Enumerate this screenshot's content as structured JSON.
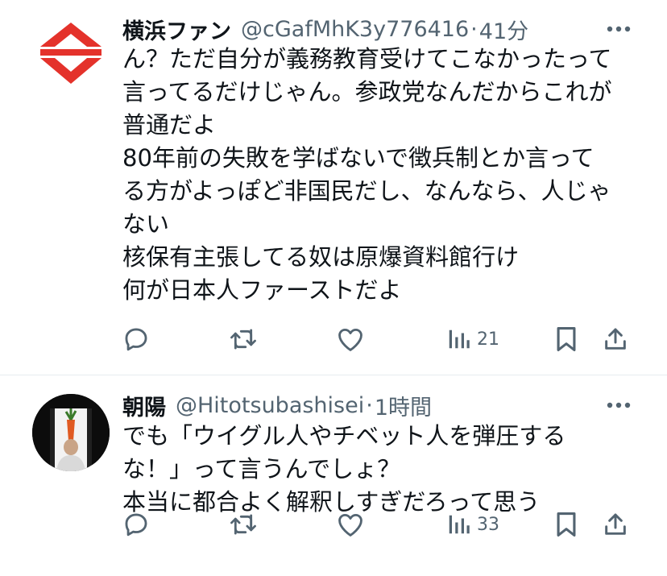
{
  "tweets": [
    {
      "display_name": "横浜ファン",
      "handle": "@cGafMhK3y776416",
      "separator": "·",
      "time": "41分",
      "avatar_icon": "red-diamond-logo-icon",
      "lines": [
        "ん？ただ自分が義務教育受けてこなかったって",
        "言ってるだけじゃん。参政党なんだからこれが",
        "普通だよ",
        "80年前の失敗を学ばないで徴兵制とか言って",
        "る方がよっぽど非国民だし、なんなら、人じゃ",
        "ない",
        "核保有主張してる奴は原爆資料館行け",
        "何が日本人ファーストだよ"
      ],
      "views": "21"
    },
    {
      "display_name": "朝陽",
      "handle": "@Hitotsubashisei",
      "separator": "·",
      "time": "1時間",
      "avatar_icon": "person-photo-icon",
      "lines": [
        "でも「ウイグル人やチベット人を弾圧する",
        "な！」って言うんでしょ？",
        "本当に都合よく解釈しすぎだろって思う"
      ],
      "views": "33"
    }
  ],
  "colors": {
    "text": "#0f1419",
    "muted": "#536471",
    "divider": "#e6ecf0",
    "logo_red": "#e4322b"
  },
  "icons": [
    "more-icon",
    "reply-icon",
    "retweet-icon",
    "like-icon",
    "views-icon",
    "bookmark-icon",
    "share-icon"
  ]
}
